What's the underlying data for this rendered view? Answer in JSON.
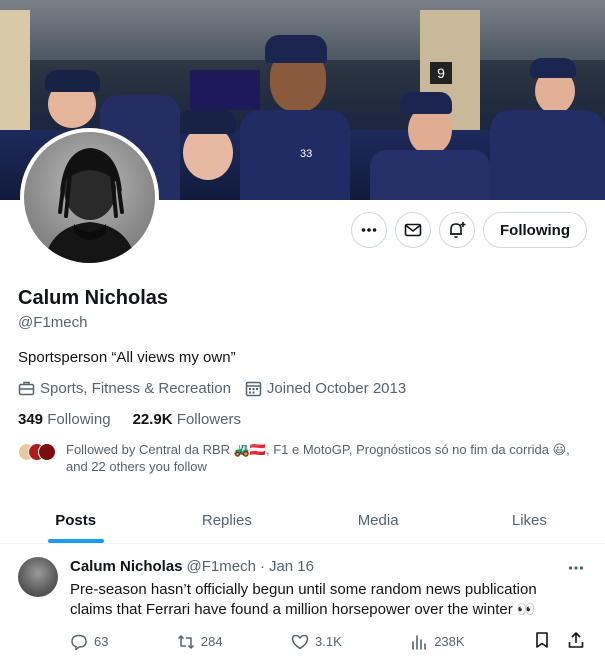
{
  "profile": {
    "name": "Calum Nicholas",
    "handle": "@F1mech",
    "bio": "Sportsperson “All views my own”",
    "category": "Sports, Fitness & Recreation",
    "joined": "Joined October 2013",
    "following_count": "349",
    "following_label": "Following",
    "followers_count": "22.9K",
    "followers_label": "Followers",
    "followed_by": "Followed by Central da RBR 🚜🇦🇹, F1 e MotoGP, Prognósticos só no fim da corrida 😃, and 22 others you follow"
  },
  "banner": {
    "number_sign": "9",
    "shirt_number": "33"
  },
  "actions": {
    "follow_label": "Following"
  },
  "tabs": [
    {
      "label": "Posts"
    },
    {
      "label": "Replies"
    },
    {
      "label": "Media"
    },
    {
      "label": "Likes"
    }
  ],
  "post": {
    "author": "Calum Nicholas",
    "handle": "@F1mech",
    "separator": "·",
    "date": "Jan 16",
    "text": "Pre-season hasn’t officially begun until some random news publication claims that Ferrari have found a million horsepower over the winter 👀",
    "replies": "63",
    "reposts": "284",
    "likes": "3.1K",
    "views": "238K"
  },
  "colors": {
    "accent": "#1d9bf0",
    "text": "#0f1419",
    "muted": "#536471",
    "border": "#cfd9de"
  },
  "icons": {
    "more": "more-icon",
    "message": "envelope-icon",
    "notify": "bell-plus-icon",
    "category": "briefcase-icon",
    "joined": "calendar-icon",
    "reply": "reply-icon",
    "repost": "repost-icon",
    "like": "heart-icon",
    "views": "views-icon",
    "bookmark": "bookmark-icon",
    "share": "share-icon"
  }
}
